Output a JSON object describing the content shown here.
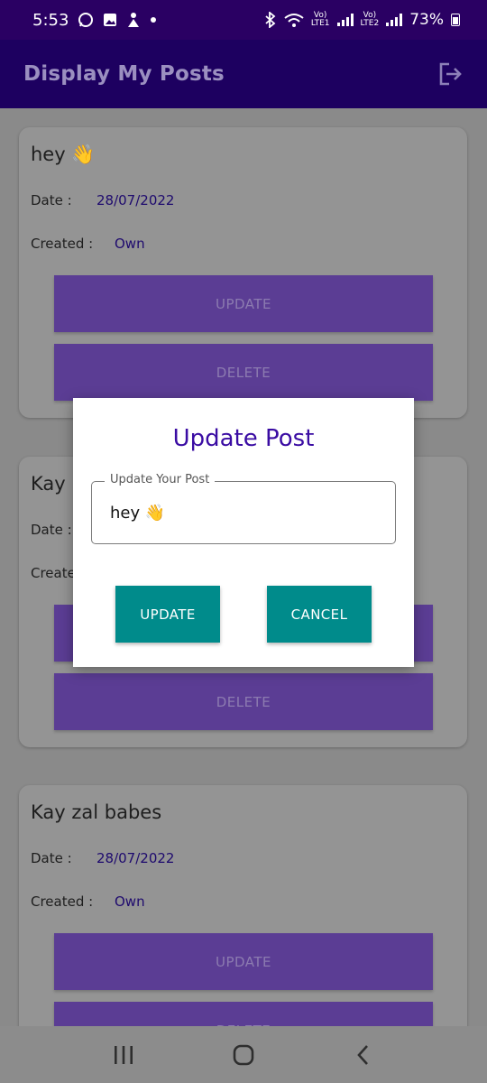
{
  "status_bar": {
    "time": "5:53",
    "sim1_label": "Vo)",
    "sim1_sub": "LTE1",
    "sim2_label": "Vo)",
    "sim2_sub": "LTE2",
    "battery": "73%"
  },
  "app_bar": {
    "title": "Display My Posts",
    "logout_icon": "logout-icon"
  },
  "posts": [
    {
      "title": "hey 👋",
      "date_label": "Date :",
      "date": "28/07/2022",
      "created_label": "Created :",
      "created": "Own",
      "update_label": "UPDATE",
      "delete_label": "DELETE"
    },
    {
      "title": "Kay k",
      "date_label": "Date :",
      "created_label": "Create",
      "delete_label": "DELETE"
    },
    {
      "title": "Kay zal babes",
      "date_label": "Date :",
      "date": "28/07/2022",
      "created_label": "Created :",
      "created": "Own",
      "update_label": "UPDATE",
      "delete_label": "DELETE"
    }
  ],
  "dialog": {
    "title": "Update Post",
    "field_label": "Update Your Post",
    "field_value": "hey 👋",
    "update_label": "UPDATE",
    "cancel_label": "CANCEL"
  },
  "colors": {
    "app_bar": "#1d0060",
    "card_button": "#5b3d94",
    "dialog_title": "#3a0ca3",
    "dialog_button": "#008b8b"
  }
}
